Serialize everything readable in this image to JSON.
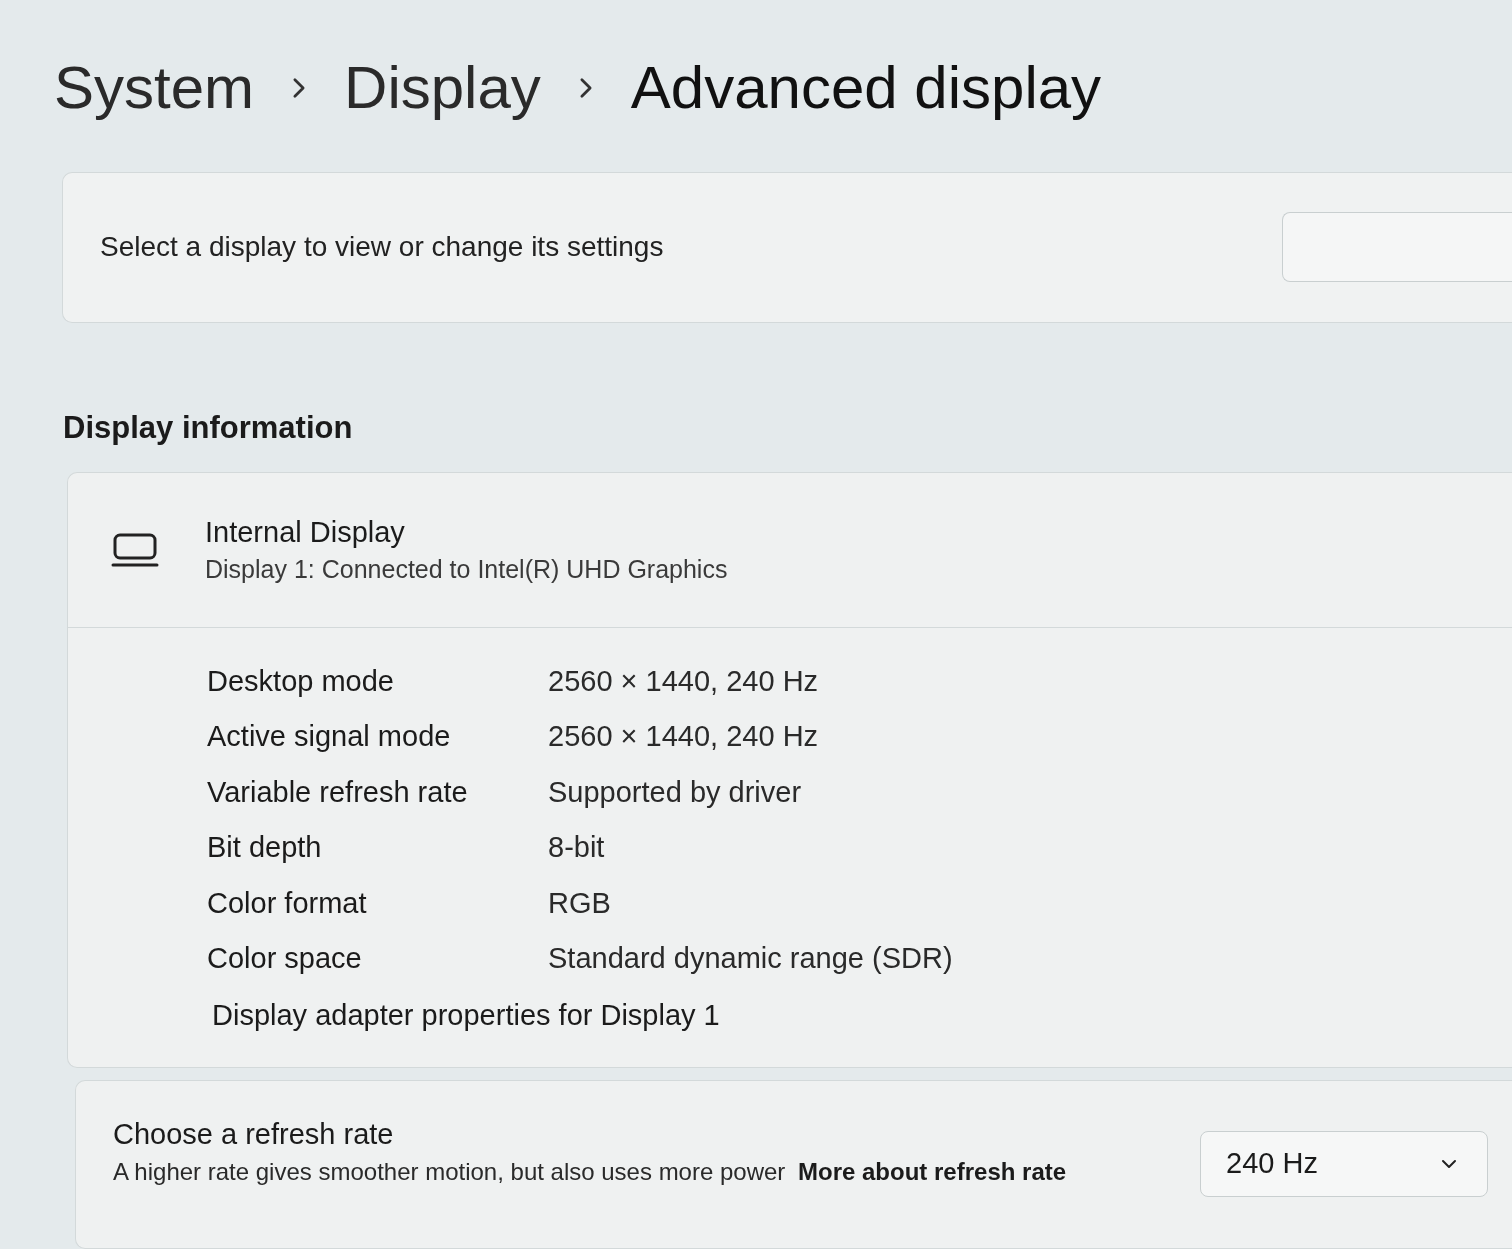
{
  "breadcrumb": [
    {
      "label": "System"
    },
    {
      "label": "Display"
    },
    {
      "label": "Advanced display"
    }
  ],
  "display_select": {
    "label": "Select a display to view or change its settings"
  },
  "display_information": {
    "heading": "Display information",
    "display": {
      "name": "Internal Display",
      "detail": "Display 1: Connected to Intel(R) UHD Graphics"
    },
    "rows": [
      {
        "label": "Desktop mode",
        "value": "2560 × 1440, 240 Hz"
      },
      {
        "label": "Active signal mode",
        "value": "2560 × 1440, 240 Hz"
      },
      {
        "label": "Variable refresh rate",
        "value": "Supported by driver"
      },
      {
        "label": "Bit depth",
        "value": "8-bit"
      },
      {
        "label": "Color format",
        "value": "RGB"
      },
      {
        "label": "Color space",
        "value": "Standard dynamic range (SDR)"
      }
    ],
    "link": "Display adapter properties for Display 1"
  },
  "refresh_rate": {
    "title": "Choose a refresh rate",
    "description": "A higher rate gives smoother motion, but also uses more power",
    "link": "More about refresh rate",
    "dropdown": {
      "value": "240 Hz"
    }
  }
}
